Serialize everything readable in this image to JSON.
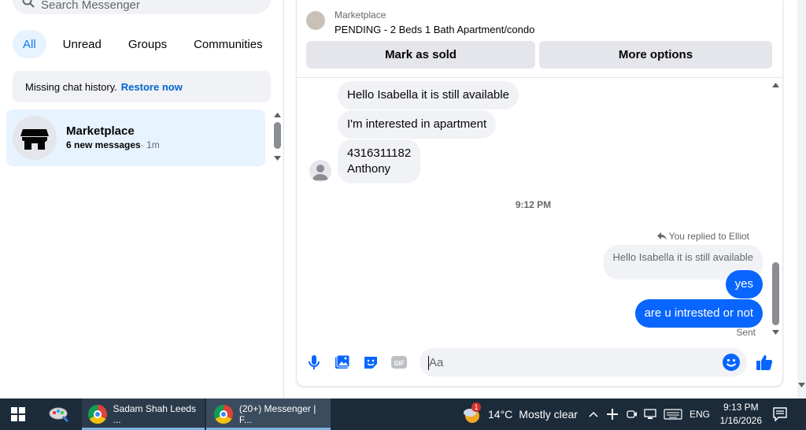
{
  "sidebar": {
    "search_placeholder": "Search Messenger",
    "filters": [
      "All",
      "Unread",
      "Groups",
      "Communities"
    ],
    "notice": {
      "text": "Missing chat history.",
      "link": "Restore now"
    },
    "chat": {
      "name": "Marketplace",
      "unread": "6 new messages",
      "time": "· 1m"
    }
  },
  "conversation": {
    "header": {
      "category": "Marketplace",
      "title": "PENDING - 2 Beds 1 Bath Apartment/condo",
      "mark_sold": "Mark as sold",
      "more_options": "More options"
    },
    "incoming": [
      "Hello Isabella it is still available",
      "I'm interested in apartment",
      "4316311182",
      "Anthony"
    ],
    "timestamp": "9:12 PM",
    "replied_to": "You replied to Elliot",
    "quoted": "Hello Isabella it is still available",
    "outgoing": [
      "yes",
      "are u intrested or not"
    ],
    "status": "Sent"
  },
  "composer": {
    "placeholder": "Aa"
  },
  "taskbar": {
    "task1": "Sadam Shah Leeds ...",
    "task2": "(20+) Messenger | F...",
    "badge": "1",
    "weather_temp": "14°C",
    "weather_desc": "Mostly clear",
    "lang": "ENG",
    "time": "9:13 PM",
    "date": "1/16/2026"
  },
  "colors": {
    "accent": "#0866ff",
    "link": "#0064d1",
    "taskbar": "#1c2b3a"
  }
}
